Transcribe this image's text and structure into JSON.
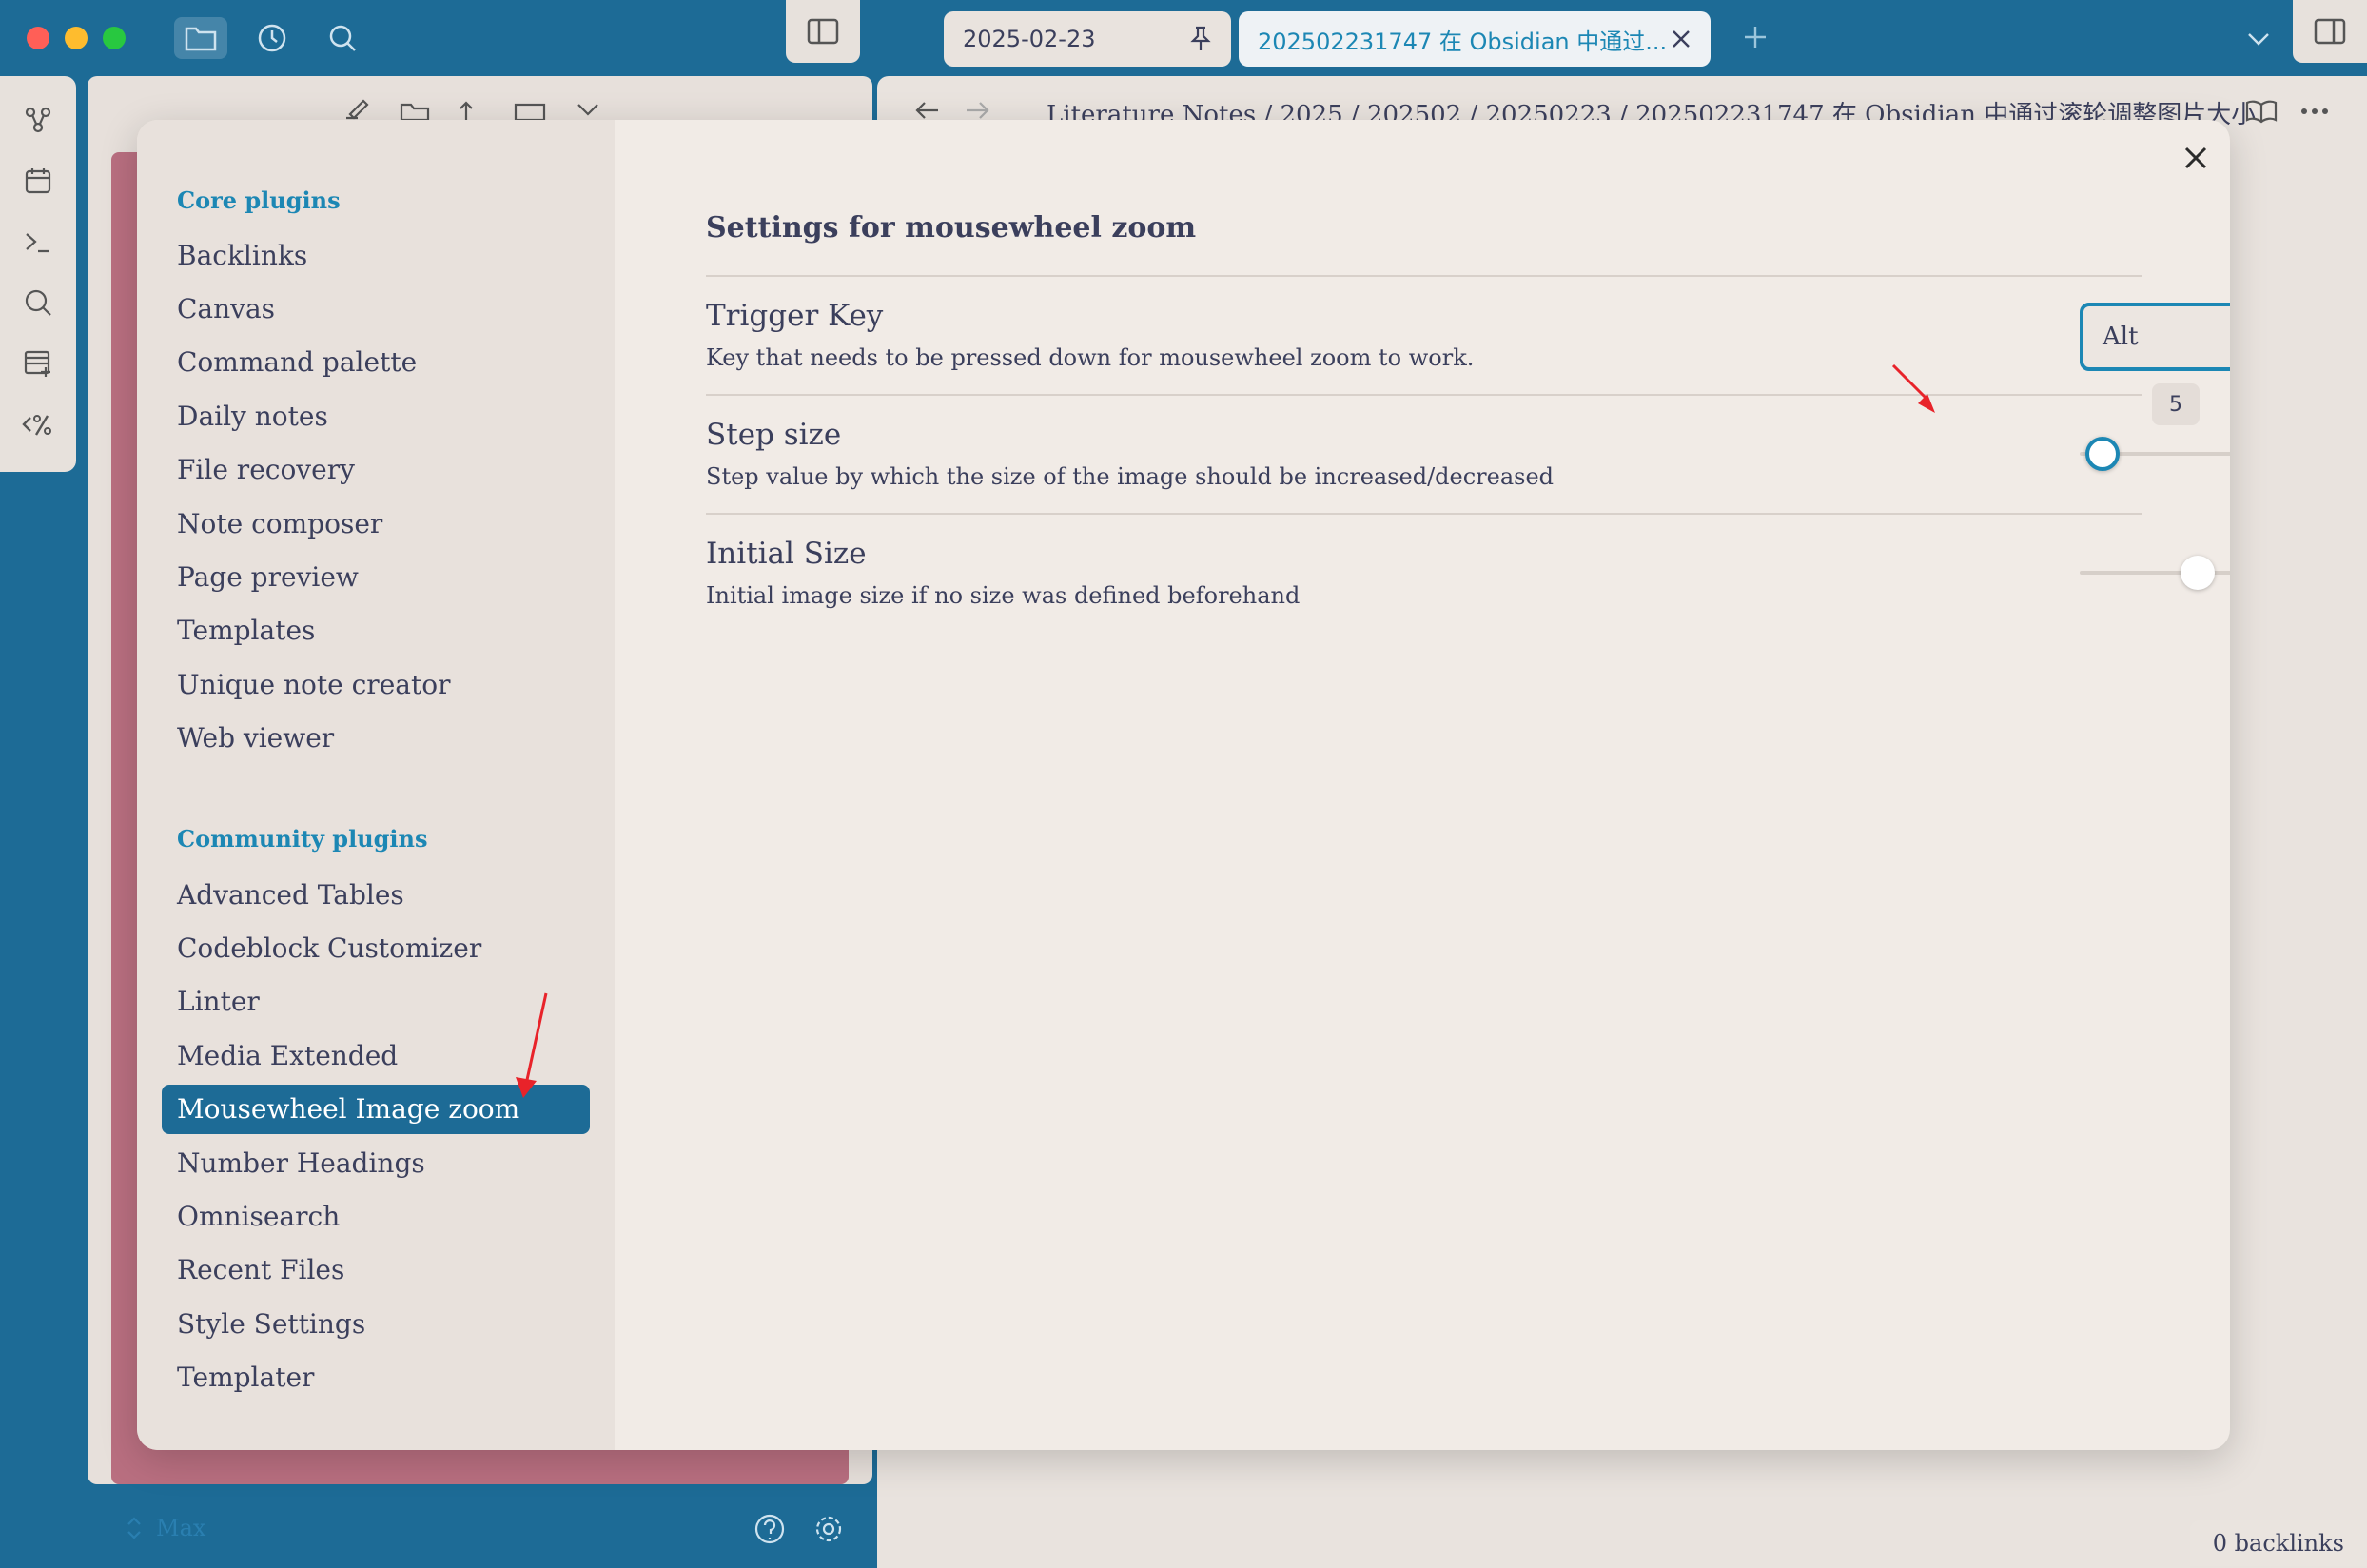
{
  "tabs": [
    {
      "label": "2025-02-23"
    },
    {
      "label": "202502231747 在 Obsidian 中通过..."
    }
  ],
  "breadcrumb": {
    "text": "Literature Notes / 2025 / 202502 / 20250223 / 202502231747 在 Obsidian 中通过滚轮调整图片大小"
  },
  "status": {
    "backlinks": "0 backlinks",
    "vault": "Max"
  },
  "modal": {
    "core_heading": "Core plugins",
    "core_plugins": [
      "Backlinks",
      "Canvas",
      "Command palette",
      "Daily notes",
      "File recovery",
      "Note composer",
      "Page preview",
      "Templates",
      "Unique note creator",
      "Web viewer"
    ],
    "community_heading": "Community plugins",
    "community_plugins": [
      "Advanced Tables",
      "Codeblock Customizer",
      "Linter",
      "Media Extended",
      "Mousewheel Image zoom",
      "Number Headings",
      "Omnisearch",
      "Recent Files",
      "Style Settings",
      "Templater"
    ],
    "active_plugin": "Mousewheel Image zoom"
  },
  "settings": {
    "title": "Settings for mousewheel zoom",
    "trigger_key": {
      "name": "Trigger Key",
      "desc": "Key that needs to be pressed down for mousewheel zoom to work.",
      "value": "Alt"
    },
    "step_size": {
      "name": "Step size",
      "desc": "Step value by which the size of the image should be increased/decreased",
      "tooltip": "5",
      "value_fraction": 0.12
    },
    "initial_size": {
      "name": "Initial Size",
      "desc": "Initial image size if no size was defined beforehand",
      "value_fraction": 0.62
    }
  },
  "colors": {
    "accent": "#1c87b4",
    "titlebar": "#1d6b96",
    "modal_bg": "#f1ebe6",
    "sidebar_bg": "#e8e1dc",
    "text": "#3b3f5c",
    "annotation_arrow": "#e8232a"
  }
}
